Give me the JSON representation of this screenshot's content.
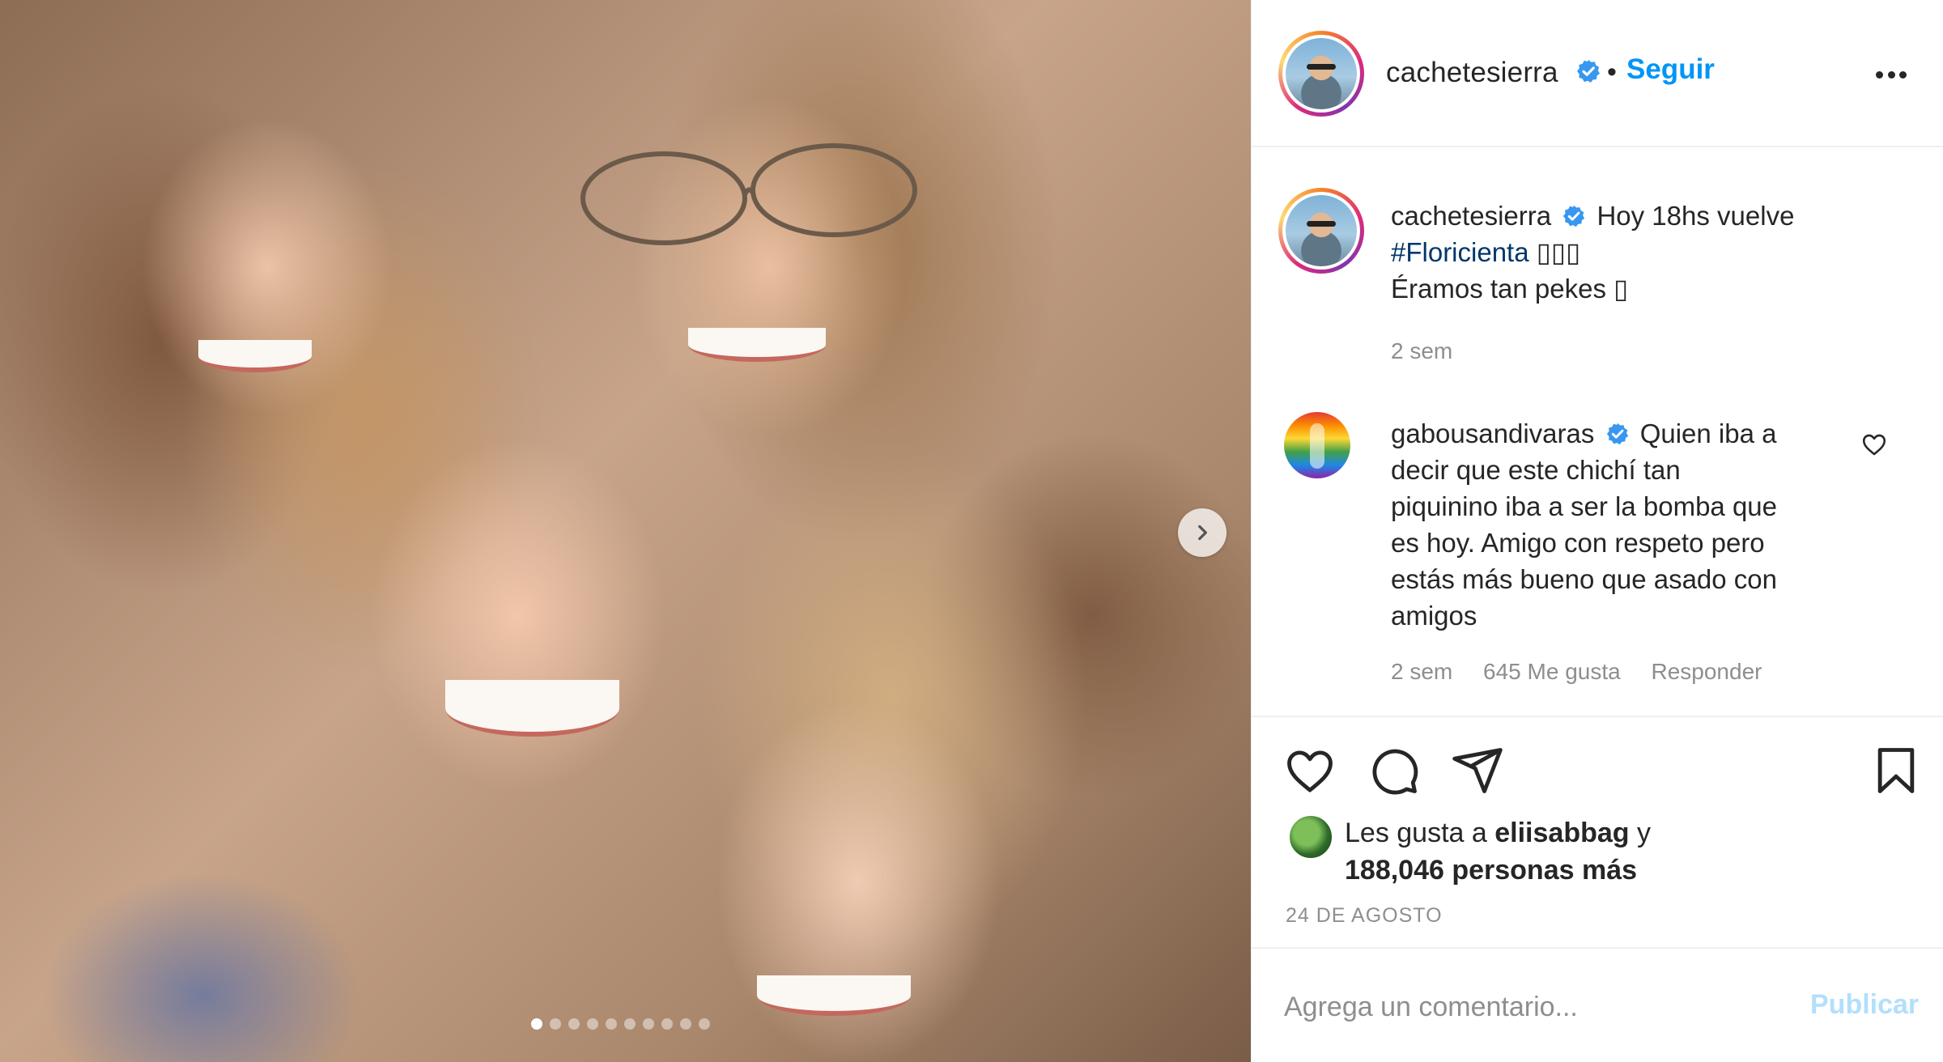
{
  "post": {
    "image_alt": "Group photo",
    "carousel": {
      "slide_count": 10,
      "active_index": 0
    }
  },
  "header": {
    "username": "cachetesierra",
    "separator": "•",
    "follow_label": "Seguir"
  },
  "caption": {
    "username": "cachetesierra",
    "line1": "Hoy 18hs vuelve",
    "hashtag": "#Floricienta",
    "emoji1": "▯▯▯",
    "line3": "Éramos tan pekes ▯",
    "time": "2 sem"
  },
  "comment": {
    "username": "gabousandivaras",
    "lines": [
      "Quien iba a",
      "decir que este chichí tan",
      "piquinino iba a ser la bomba que",
      "es hoy. Amigo con respeto pero",
      "estás más bueno que asado con",
      "amigos"
    ],
    "time": "2 sem",
    "likes": "645 Me gusta",
    "reply": "Responder"
  },
  "likes": {
    "prefix": "Les gusta a",
    "user": "eliisabbag",
    "suffix": "y",
    "count": "188,046 personas más"
  },
  "date": "24 DE AGOSTO",
  "add_comment": {
    "placeholder": "Agrega un comentario...",
    "publish": "Publicar"
  },
  "colors": {
    "link": "#0095f6",
    "hashtag": "#00376b",
    "muted": "#8e8e8e",
    "publish_disabled": "#b2dffc",
    "verified": "#3897f0"
  },
  "icons": [
    "chevron-right-icon",
    "more-icon",
    "verified-icon",
    "heart-icon",
    "comment-icon",
    "share-icon",
    "bookmark-icon"
  ]
}
